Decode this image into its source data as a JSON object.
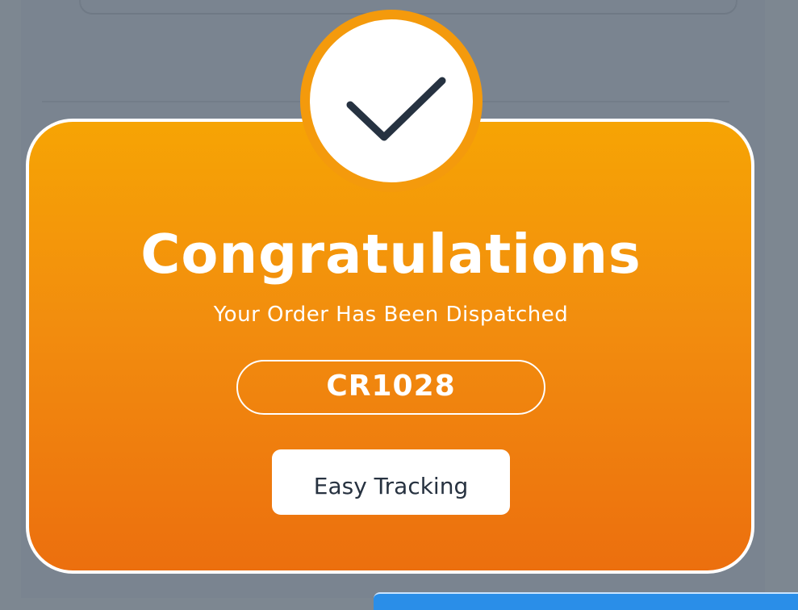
{
  "modal": {
    "title": "Congratulations",
    "subtitle": "Your Order Has Been Dispatched",
    "order_code": "CR1028",
    "action_label": "Easy Tracking",
    "icon": "checkmark-icon"
  },
  "colors": {
    "gradient_top": "#f6a404",
    "gradient_bottom": "#ec6f0e",
    "ring": "#f49a0c",
    "check": "#263241",
    "overlay": "#7d8791"
  }
}
